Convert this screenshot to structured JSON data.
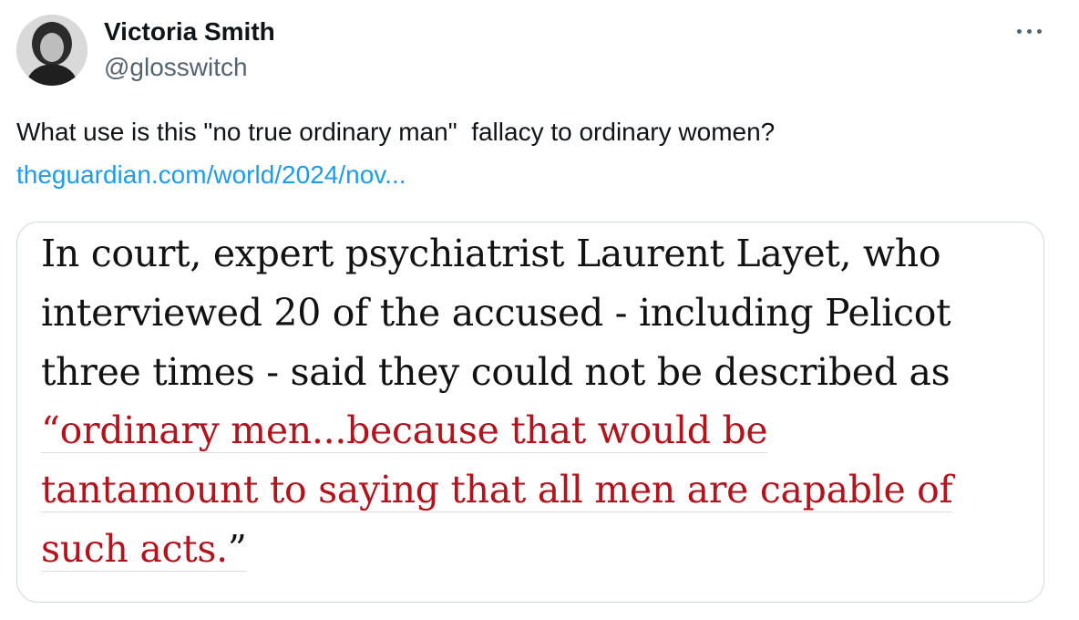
{
  "tweet": {
    "author": {
      "display_name": "Victoria Smith",
      "handle": "@glosswitch"
    },
    "text": "What use is this \"no true ordinary man\"  fallacy to ordinary women?",
    "link_text": "theguardian.com/world/2024/nov...",
    "more_icon": "more-horizontal-icon"
  },
  "media": {
    "quote_lines": [
      "In court, expert psychiatrist Laurent Layet, who",
      "interviewed 20 of the accused - including Pelicot",
      "three times - said they could not be described as"
    ],
    "highlight_lines": [
      "“ordinary men...because that would be",
      "tantamount to saying that all men are capable of",
      "such acts."
    ],
    "closing_quote": "”"
  },
  "colors": {
    "link": "#1d9bf0",
    "quote_highlight": "#b3131c",
    "secondary_text": "#536471",
    "border": "#cfd9de"
  }
}
